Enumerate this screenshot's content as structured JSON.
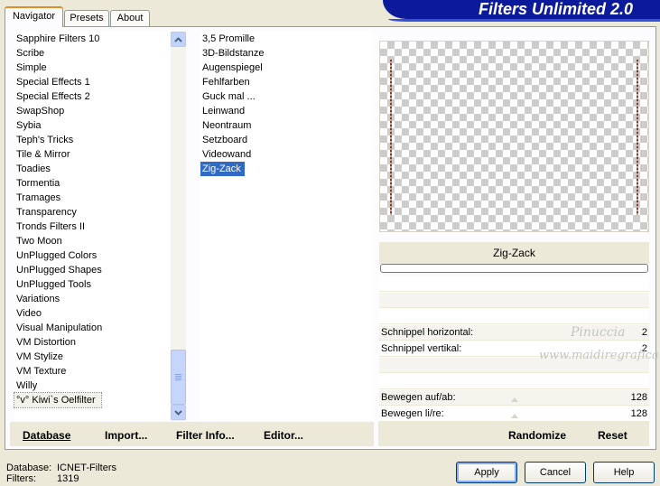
{
  "tabs": [
    {
      "label": "Navigator"
    },
    {
      "label": "Presets"
    },
    {
      "label": "About"
    }
  ],
  "banner": {
    "title": "Filters Unlimited 2.0"
  },
  "categories": {
    "items": [
      "Sapphire Filters 10",
      "Scribe",
      "Simple",
      "Special Effects 1",
      "Special Effects 2",
      "SwapShop",
      "Sybia",
      "Teph's Tricks",
      "Tile & Mirror",
      "Toadies",
      "Tormentia",
      "Tramages",
      "Transparency",
      "Tronds Filters II",
      "Two Moon",
      "UnPlugged Colors",
      "UnPlugged Shapes",
      "UnPlugged Tools",
      "Variations",
      "Video",
      "Visual Manipulation",
      "VM Distortion",
      "VM Stylize",
      "VM Texture",
      "Willy",
      "°v° Kiwi`s Oelfilter"
    ],
    "selected_index": 25
  },
  "filters": {
    "items": [
      "3,5 Promille",
      "3D-Bildstanze",
      "Augenspiegel",
      "Fehlfarben",
      "Guck mal ...",
      "Leinwand",
      "Neontraum",
      "Setzboard",
      "Videowand",
      "Zig-Zack"
    ],
    "selected_index": 9
  },
  "links": {
    "database": "Database",
    "import": "Import...",
    "filter_info": "Filter Info...",
    "editor": "Editor..."
  },
  "preview": {
    "filter_name": "Zig-Zack"
  },
  "controls": [
    {
      "label": "Schnippel horizontal:",
      "value": "2"
    },
    {
      "label": "Schnippel vertikal:",
      "value": "2"
    },
    {
      "label": "Bewegen auf/ab:",
      "value": "128"
    },
    {
      "label": "Bewegen li/re:",
      "value": "128"
    }
  ],
  "watermark": {
    "line1": "Pinuccia",
    "line2": "www.maidiregrafica.eu"
  },
  "actions": {
    "randomize": "Randomize",
    "reset": "Reset"
  },
  "footer": {
    "database_label": "Database:",
    "database_value": "ICNET-Filters",
    "filters_label": "Filters:",
    "filters_value": "1319"
  },
  "buttons": {
    "apply": "Apply",
    "cancel": "Cancel",
    "help": "Help"
  },
  "colors": {
    "accent": "#316ac5",
    "banner": "#0b1a9a",
    "tab_highlight": "#e68b2c"
  }
}
